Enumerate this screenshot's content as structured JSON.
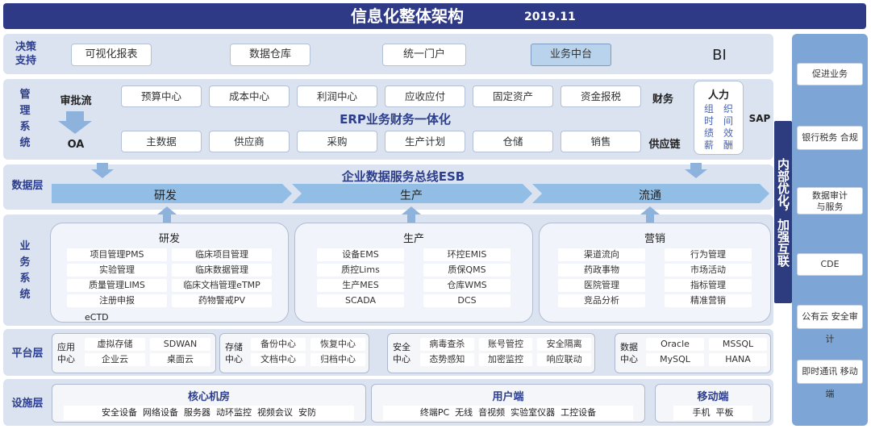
{
  "header": {
    "title": "信息化整体架构",
    "date": "2019.11"
  },
  "decision": {
    "label_l1": "决策",
    "label_l2": "支持",
    "items": [
      "可视化报表",
      "数据仓库",
      "统一门户",
      "业务中台"
    ],
    "bi": "BI"
  },
  "management": {
    "label": [
      "管",
      "理",
      "系",
      "统"
    ],
    "approval": "审批流",
    "oa": "OA",
    "finance_boxes": [
      "预算中心",
      "成本中心",
      "利润中心",
      "应收应付",
      "固定资产",
      "资金报税"
    ],
    "finance_label": "财务",
    "erp_title": "ERP业务财务一体化",
    "supply_boxes": [
      "主数据",
      "供应商",
      "采购",
      "生产计划",
      "仓储",
      "销售"
    ],
    "supply_label": "供应链",
    "hr": {
      "title": "人力",
      "col1": [
        "组",
        "时",
        "绩",
        "薪"
      ],
      "col2": [
        "织",
        "间",
        "效",
        "酬"
      ]
    },
    "sap": "SAP"
  },
  "data_layer": {
    "label": "数据层",
    "esb_title": "企业数据服务总线ESB",
    "segments": [
      "研发",
      "生产",
      "流通"
    ]
  },
  "business": {
    "label": [
      "业",
      "务",
      "系",
      "统"
    ],
    "panels": [
      {
        "title": "研发",
        "items": [
          "项目管理PMS",
          "临床项目管理",
          "实验管理",
          "临床数据管理",
          "质量管理LIMS",
          "临床文档管理eTMP",
          "注册申报",
          "药物警戒PV"
        ],
        "extra": "eCTD"
      },
      {
        "title": "生产",
        "items": [
          "设备EMS",
          "环控EMIS",
          "质控Lims",
          "质保QMS",
          "生产MES",
          "仓库WMS",
          "SCADA",
          "DCS"
        ]
      },
      {
        "title": "营销",
        "items": [
          "渠道流向",
          "行为管理",
          "药政事物",
          "市场活动",
          "医院管理",
          "指标管理",
          "竞品分析",
          "精准营销"
        ]
      }
    ]
  },
  "platform": {
    "label": "平台层",
    "groups": [
      {
        "l1": "应用",
        "l2": "中心",
        "items": [
          "虚拟存储",
          "SDWAN",
          "企业云",
          "桌面云"
        ]
      },
      {
        "l1": "存储",
        "l2": "中心",
        "items": [
          "备份中心",
          "恢复中心",
          "文档中心",
          "归档中心"
        ]
      },
      {
        "l1": "安全",
        "l2": "中心",
        "items": [
          "病毒查杀",
          "账号管控",
          "安全隔离",
          "态势感知",
          "加密监控",
          "响应联动"
        ]
      },
      {
        "l1": "数据",
        "l2": "中心",
        "items": [
          "Oracle",
          "MSSQL",
          "MySQL",
          "HANA"
        ]
      }
    ]
  },
  "infra": {
    "label": "设施层",
    "groups": [
      {
        "title": "核心机房",
        "items": "安全设备  网络设备  服务器  动环监控  视频会议  安防"
      },
      {
        "title": "用户端",
        "items": "终端PC  无线  音视频  实验室仪器  工控设备"
      },
      {
        "title": "移动端",
        "items": "手机  平板"
      }
    ]
  },
  "side": {
    "vertical": "内部优化，加强互联",
    "items": [
      "促进业务",
      "银行税务 合规",
      "数据审计与服务",
      "CDE",
      "公有云 安全审计",
      "即时通讯 移动端"
    ]
  },
  "colors": {
    "banner": "#2f3a87",
    "accent": "#2d3e8c",
    "row_bg": "#dbe3f0",
    "side_bg": "#7da6d6",
    "arrow": "#8db3dd"
  }
}
